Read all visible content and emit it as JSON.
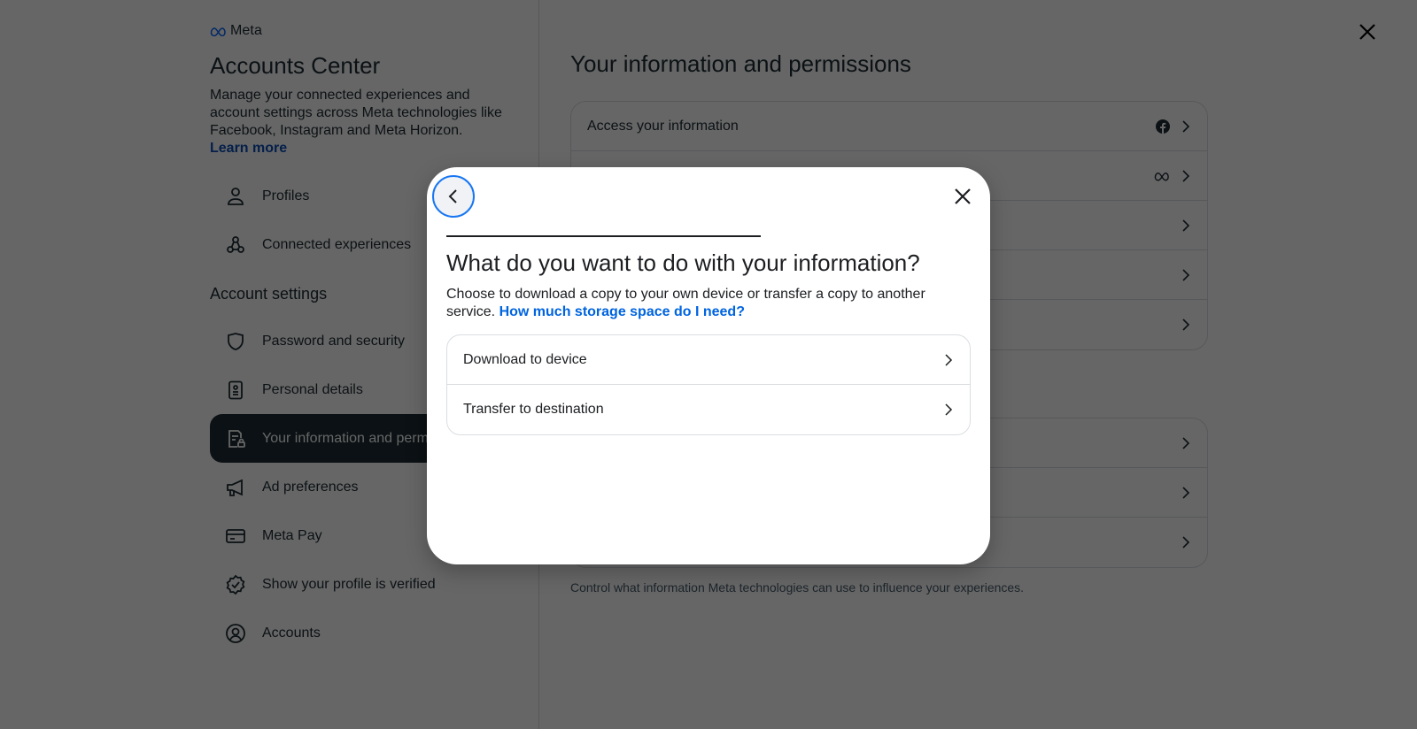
{
  "brand": {
    "name": "Meta",
    "logo_icon": "meta-infinity-logo"
  },
  "sidebar": {
    "title": "Accounts Center",
    "description": "Manage your connected experiences and account settings across Meta technologies like Facebook, Instagram and Meta Horizon.",
    "learn_more": "Learn more",
    "top_items": [
      {
        "label": "Profiles",
        "icon": "person-icon"
      },
      {
        "label": "Connected experiences",
        "icon": "connected-nodes-icon"
      }
    ],
    "section_heading": "Account settings",
    "items": [
      {
        "label": "Password and security",
        "icon": "shield-icon",
        "active": false
      },
      {
        "label": "Personal details",
        "icon": "id-card-icon",
        "active": false
      },
      {
        "label": "Your information and permissions",
        "icon": "document-lock-icon",
        "active": true
      },
      {
        "label": "Ad preferences",
        "icon": "megaphone-icon",
        "active": false
      },
      {
        "label": "Meta Pay",
        "icon": "credit-card-icon",
        "active": false
      },
      {
        "label": "Show your profile is verified",
        "icon": "verified-badge-icon",
        "active": false
      },
      {
        "label": "Accounts",
        "icon": "account-circle-icon",
        "active": false
      }
    ]
  },
  "main": {
    "title": "Your information and permissions",
    "card1_rows": [
      {
        "label": "Access your information",
        "badge": "facebook-icon"
      },
      {
        "label": "",
        "badge": "meta-icon"
      },
      {
        "label": "",
        "badge": ""
      },
      {
        "label": "",
        "badge": ""
      },
      {
        "label": "",
        "badge": ""
      }
    ],
    "card2_rows": [
      {
        "label": ""
      },
      {
        "label": ""
      },
      {
        "label": ""
      }
    ],
    "footer_text": "Control what information Meta technologies can use to influence your experiences."
  },
  "dialog": {
    "title": "What do you want to do with your information?",
    "description": "Choose to download a copy to your own device or transfer a copy to another service.",
    "help_link": "How much storage space do I need?",
    "options": [
      {
        "label": "Download to device"
      },
      {
        "label": "Transfer to destination"
      }
    ],
    "progress_fraction": 0.6
  },
  "colors": {
    "accent": "#0064e0",
    "focus_ring": "#1877f2",
    "active_nav": "#1c2b33",
    "overlay": "rgba(0,0,0,0.6)"
  }
}
